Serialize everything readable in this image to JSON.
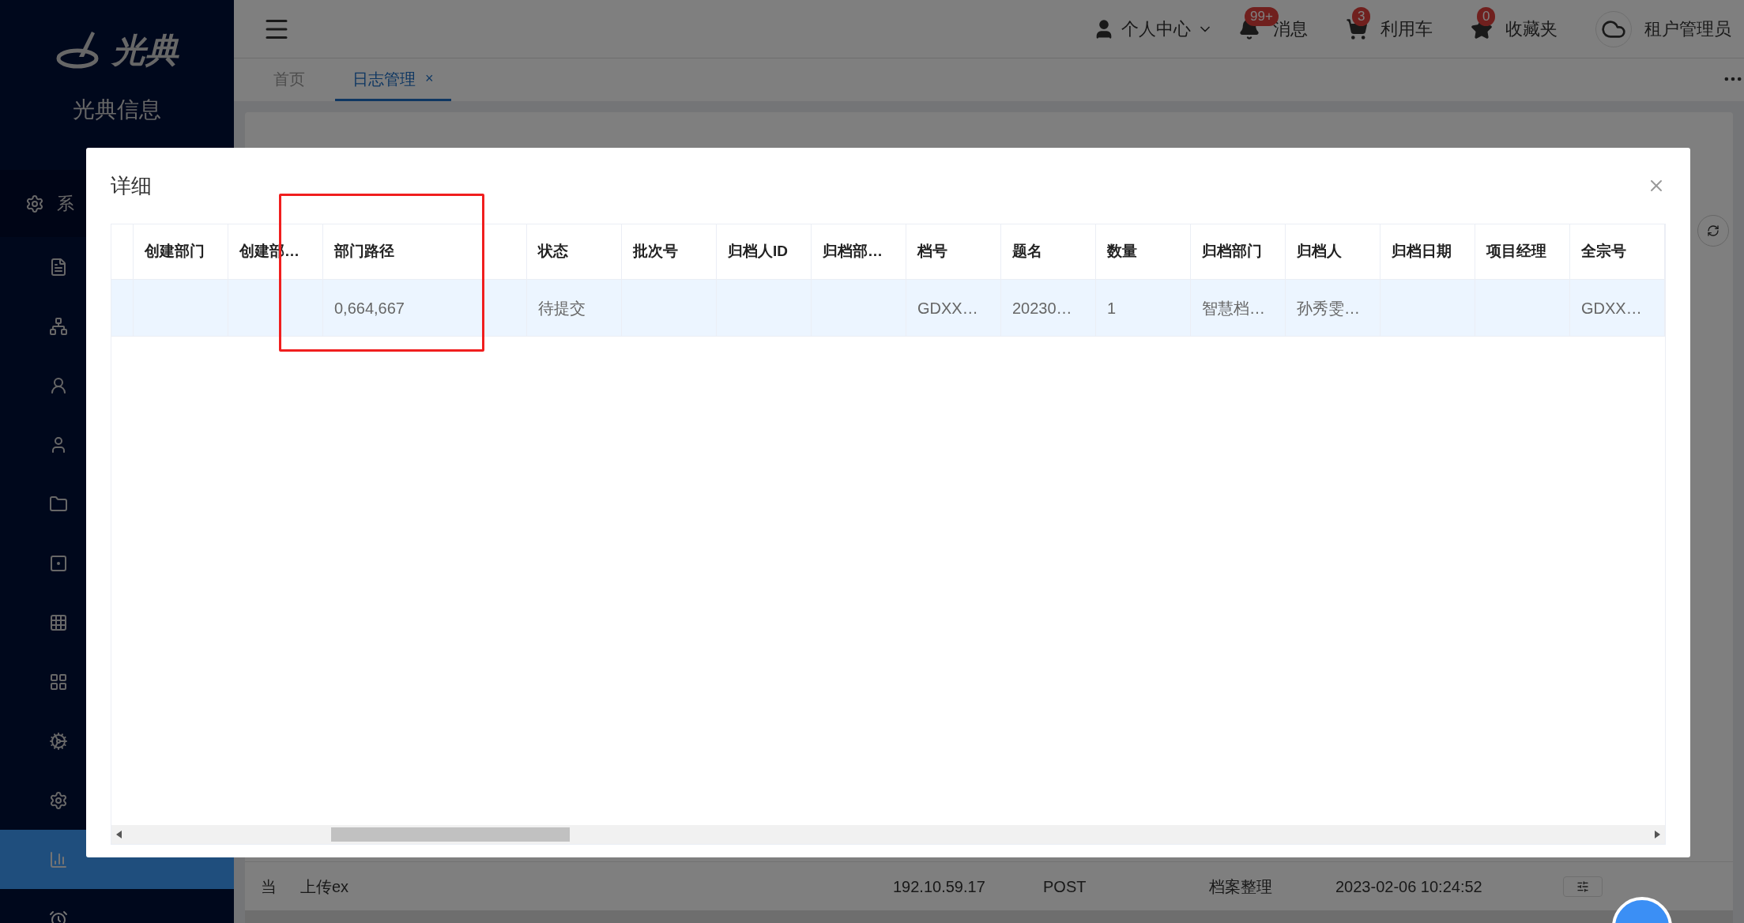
{
  "sidebar": {
    "logo_text": "光典",
    "title": "光典信息",
    "group_label": "系",
    "items": [
      {
        "selected": true
      },
      {
        "selected": false
      }
    ]
  },
  "header": {
    "user_menu": "个人中心",
    "shortcuts": [
      {
        "label": "消息",
        "badge": "99+"
      },
      {
        "label": "利用车",
        "badge": "3"
      },
      {
        "label": "收藏夹",
        "badge": "0"
      }
    ],
    "account": "租户管理员"
  },
  "tabs": [
    {
      "label": "首页",
      "selected": false
    },
    {
      "label": "日志管理",
      "selected": true,
      "close": "×"
    }
  ],
  "background_row": [
    "当",
    "上传ex",
    "192.10.59.17",
    "POST",
    "档案整理",
    "2023-02-06 10:24:52"
  ],
  "dialog": {
    "title": "详细",
    "columns": [
      "创建部门",
      "创建部…",
      "部门路径",
      "状态",
      "批次号",
      "归档人ID",
      "归档部…",
      "档号",
      "题名",
      "数量",
      "归档部门",
      "归档人",
      "归档日期",
      "项目经理",
      "全宗号"
    ],
    "rows": [
      {
        "selected": true,
        "cells": [
          null,
          null,
          "0,664,667",
          "待提交",
          null,
          null,
          null,
          "GDXX…",
          "20230…",
          "1",
          "智慧档…",
          "孙秀雯…",
          null,
          null,
          "GDXX…"
        ]
      }
    ]
  }
}
